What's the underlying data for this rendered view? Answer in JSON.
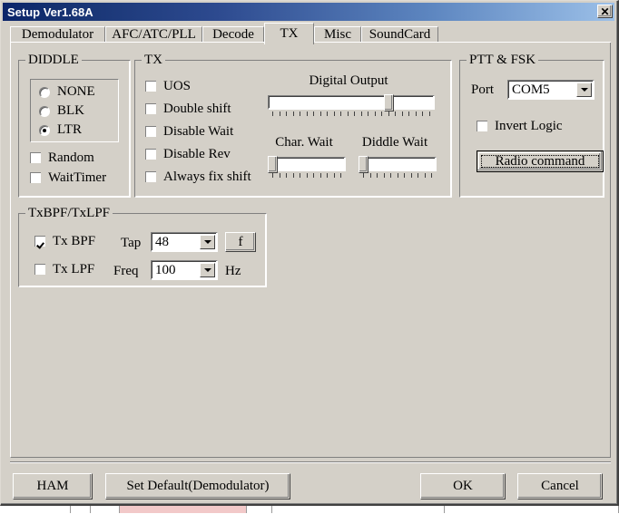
{
  "window": {
    "title": "Setup Ver1.68A",
    "close_label": "✕",
    "titlebar_gradient_start": "#0a246a",
    "titlebar_gradient_end": "#9cc0e8",
    "face_color": "#d4d0c8"
  },
  "tabs": [
    {
      "label": "Demodulator",
      "selected": false
    },
    {
      "label": "AFC/ATC/PLL",
      "selected": false
    },
    {
      "label": "Decode",
      "selected": false
    },
    {
      "label": "TX",
      "selected": true
    },
    {
      "label": "Misc",
      "selected": false
    },
    {
      "label": "SoundCard",
      "selected": false
    }
  ],
  "diddle_group": {
    "title": "DIDDLE",
    "radios": [
      {
        "label": "NONE",
        "checked": false
      },
      {
        "label": "BLK",
        "checked": false
      },
      {
        "label": "LTR",
        "checked": true
      }
    ],
    "checkboxes": [
      {
        "label": "Random",
        "checked": false
      },
      {
        "label": "WaitTimer",
        "checked": false
      }
    ]
  },
  "tx_group": {
    "title": "TX",
    "checkboxes": [
      {
        "label": "UOS",
        "checked": false
      },
      {
        "label": "Double shift",
        "checked": false
      },
      {
        "label": "Disable Wait",
        "checked": false
      },
      {
        "label": "Disable Rev",
        "checked": false
      },
      {
        "label": "Always fix shift",
        "checked": false
      }
    ],
    "sliders": [
      {
        "label": "Digital Output",
        "value_percent": 74,
        "ticks": 24
      },
      {
        "label": "Char. Wait",
        "value_percent": 0,
        "ticks": 11
      },
      {
        "label": "Diddle Wait",
        "value_percent": 0,
        "ticks": 11
      }
    ]
  },
  "ptt_fsk_group": {
    "title": "PTT & FSK",
    "port_label": "Port",
    "port_value": "COM5",
    "invert_logic": {
      "label": "Invert Logic",
      "checked": false
    },
    "radio_command_label": "Radio command"
  },
  "txbpf_group": {
    "title": "TxBPF/TxLPF",
    "tx_bpf": {
      "label": "Tx BPF",
      "checked": true
    },
    "tx_lpf": {
      "label": "Tx LPF",
      "checked": false
    },
    "tap_label": "Tap",
    "tap_value": "48",
    "f_button_label": "f",
    "freq_label": "Freq",
    "freq_value": "100",
    "hz_label": "Hz"
  },
  "footer": {
    "ham_label": "HAM",
    "set_default_label": "Set Default(Demodulator)",
    "ok_label": "OK",
    "cancel_label": "Cancel"
  },
  "background": {
    "cells": [
      "",
      "",
      "",
      "",
      "",
      "",
      ""
    ]
  }
}
